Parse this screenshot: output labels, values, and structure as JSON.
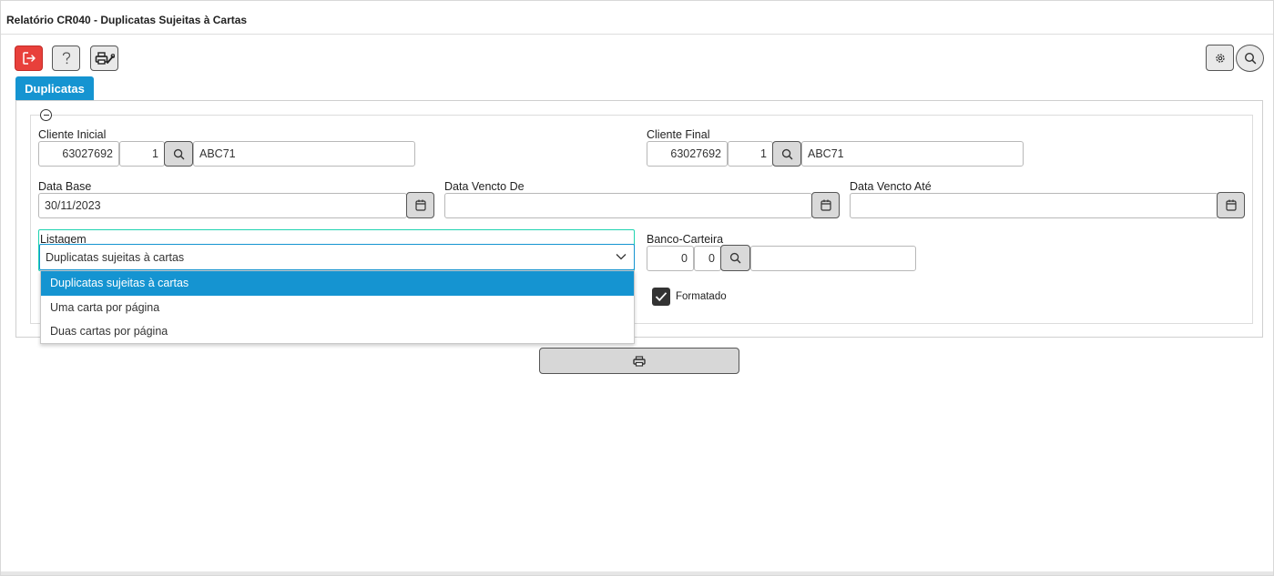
{
  "window": {
    "title": "Relatório CR040 - Duplicatas Sujeitas à Cartas"
  },
  "toolbar": {
    "exit_icon": "exit-icon",
    "help_icon": "question-icon",
    "printer_setup_icon": "printer-wrench-icon",
    "settings_icon": "gear-icon",
    "search_icon": "search-icon",
    "exit_color": "#e8403b"
  },
  "tabs": [
    {
      "label": "Duplicatas",
      "active": true
    }
  ],
  "form": {
    "cliente_inicial": {
      "label": "Cliente Inicial",
      "code": "63027692",
      "seq": "1",
      "name": "ABC71"
    },
    "cliente_final": {
      "label": "Cliente Final",
      "code": "63027692",
      "seq": "1",
      "name": "ABC71"
    },
    "data_base": {
      "label": "Data Base",
      "value": "30/11/2023"
    },
    "data_vencto_de": {
      "label": "Data Vencto De",
      "value": ""
    },
    "data_vencto_ate": {
      "label": "Data Vencto Até",
      "value": ""
    },
    "listagem": {
      "label": "Listagem",
      "selected": "Duplicatas sujeitas à cartas",
      "options": [
        "Duplicatas sujeitas à cartas",
        "Uma carta por página",
        "Duas cartas por página"
      ],
      "open": true
    },
    "banco_carteira": {
      "label": "Banco-Carteira",
      "banco": "0",
      "carteira": "0",
      "descricao": ""
    },
    "formatado": {
      "label": "Formatado",
      "checked": true
    }
  },
  "print_button": {
    "icon": "printer-icon"
  },
  "colors": {
    "accent": "#1594d1",
    "focus_outline": "#1fd3b0"
  }
}
